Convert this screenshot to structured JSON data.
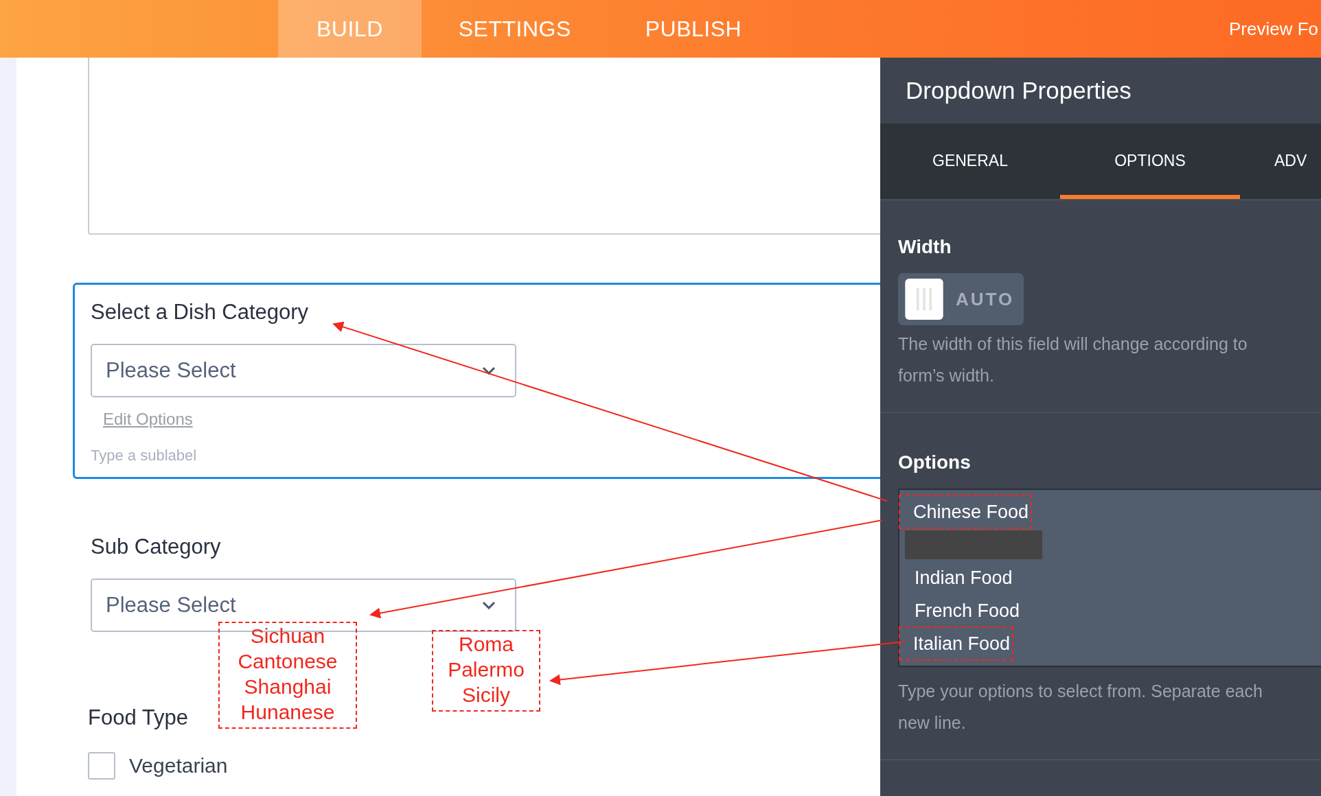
{
  "top_tabs": [
    {
      "label": "BUILD",
      "selected": true
    },
    {
      "label": "SETTINGS",
      "selected": false
    },
    {
      "label": "PUBLISH",
      "selected": false
    }
  ],
  "preview_button": "Preview Fo",
  "form": {
    "fields": [
      {
        "kind": "dropdown",
        "label": "Select a Dish Category",
        "value": "Please Select",
        "active": true,
        "edit_link": "Edit Options",
        "sublabel_placeholder": "Type a sublabel"
      },
      {
        "kind": "dropdown",
        "label": "Sub Category",
        "value": "Please Select",
        "active": false
      },
      {
        "kind": "checkboxes",
        "label": "Food Type",
        "options": [
          {
            "label": "Vegetarian",
            "checked": false
          }
        ]
      }
    ]
  },
  "panel": {
    "title": "Dropdown Properties",
    "tabs": [
      {
        "label": "GENERAL",
        "selected": false
      },
      {
        "label": "OPTIONS",
        "selected": true
      },
      {
        "label": "ADV",
        "selected": false
      }
    ],
    "width": {
      "heading": "Width",
      "toggle_label": "AUTO",
      "description_lines": [
        "The width of this field will change according to",
        "form’s width."
      ]
    },
    "options": {
      "heading": "Options",
      "items": [
        {
          "kind": "text",
          "label": "Chinese Food",
          "annotated": true
        },
        {
          "kind": "redacted",
          "annotated": false
        },
        {
          "kind": "text",
          "label": "Indian Food",
          "annotated": false
        },
        {
          "kind": "text",
          "label": "French Food",
          "annotated": false
        },
        {
          "kind": "text",
          "label": "Italian Food",
          "annotated": true
        }
      ],
      "help_lines": [
        "Type your options to select from. Separate each",
        "new line."
      ]
    }
  },
  "annotations": [
    {
      "lines": [
        "Sichuan",
        "Cantonese",
        "Shanghai",
        "Hunanese"
      ]
    },
    {
      "lines": [
        "Roma",
        "Palermo",
        "Sicily"
      ]
    }
  ]
}
